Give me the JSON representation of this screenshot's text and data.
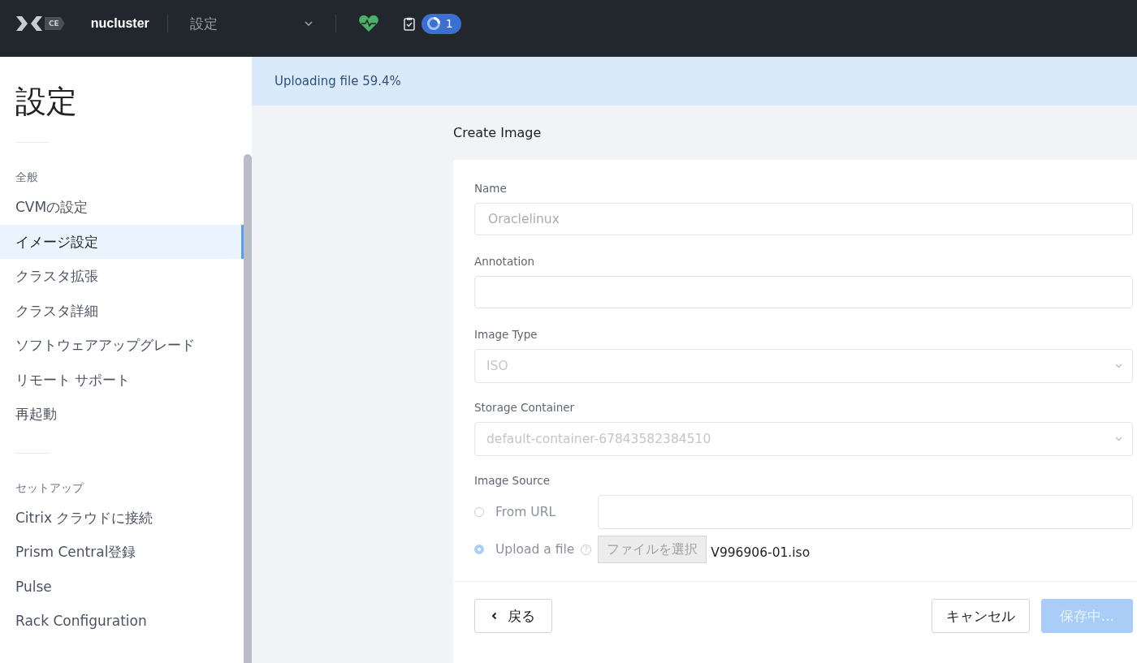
{
  "topbar": {
    "logo_badge": "CE",
    "cluster": "nucluster",
    "page_select": "設定",
    "task_count": "1"
  },
  "sidebar": {
    "title": "設定",
    "sections": [
      {
        "header": "全般",
        "items": [
          {
            "label": "CVMの設定",
            "selected": false
          },
          {
            "label": "イメージ設定",
            "selected": true
          },
          {
            "label": "クラスタ拡張",
            "selected": false
          },
          {
            "label": "クラスタ詳細",
            "selected": false
          },
          {
            "label": "ソフトウェアアップグレード",
            "selected": false
          },
          {
            "label": "リモート サポート",
            "selected": false
          },
          {
            "label": "再起動",
            "selected": false
          }
        ]
      },
      {
        "header": "セットアップ",
        "items": [
          {
            "label": "Citrix クラウドに接続",
            "selected": false
          },
          {
            "label": "Prism Central登録",
            "selected": false
          },
          {
            "label": "Pulse",
            "selected": false
          },
          {
            "label": "Rack Configuration",
            "selected": false
          }
        ]
      }
    ]
  },
  "banner": "Uploading file 59.4%",
  "form": {
    "title": "Create Image",
    "fields": [
      {
        "kind": "text",
        "label": "Name",
        "value": "Oraclelinux",
        "disabled": true
      },
      {
        "kind": "text",
        "label": "Annotation"
      },
      {
        "kind": "select",
        "label": "Image Type",
        "value": "ISO",
        "disabled": true
      },
      {
        "kind": "select",
        "label": "Storage Container",
        "value": "default-container-67843582384510",
        "disabled": true
      }
    ],
    "source": {
      "label": "Image Source",
      "options": [
        {
          "kind": "url",
          "label": "From URL",
          "selected": false
        },
        {
          "kind": "file",
          "label": "Upload a file",
          "selected": true,
          "help": "?",
          "button": "ファイルを選択",
          "file": "V996906-01.iso"
        }
      ]
    },
    "back": "戻る",
    "cancel": "キャンセル",
    "save": {
      "label": "保存中...",
      "disabled": true
    }
  }
}
